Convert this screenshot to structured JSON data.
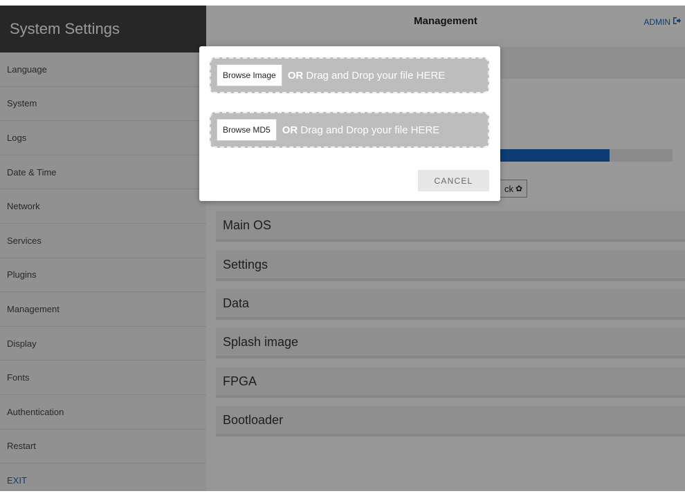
{
  "sidebar": {
    "title": "System Settings",
    "items": [
      {
        "label": "Language"
      },
      {
        "label": "System"
      },
      {
        "label": "Logs"
      },
      {
        "label": "Date & Time"
      },
      {
        "label": "Network"
      },
      {
        "label": "Services"
      },
      {
        "label": "Plugins"
      },
      {
        "label": "Management"
      },
      {
        "label": "Display"
      },
      {
        "label": "Fonts"
      },
      {
        "label": "Authentication"
      },
      {
        "label": "Restart"
      },
      {
        "label": "EXIT"
      }
    ]
  },
  "header": {
    "title": "Management",
    "user_label": "ADMIN",
    "user_icon": "logout-icon"
  },
  "update_panel": {
    "progress_fraction": 0.84,
    "check_label": "ck",
    "check_icon": "gear-icon",
    "accent_color": "#1565c0"
  },
  "sections": [
    {
      "label": "Main OS"
    },
    {
      "label": "Settings"
    },
    {
      "label": "Data"
    },
    {
      "label": "Splash image"
    },
    {
      "label": "FPGA"
    },
    {
      "label": "Bootloader"
    }
  ],
  "modal": {
    "image_drop": {
      "button_label": "Browse Image",
      "or_label": "OR",
      "drop_text": "Drag and Drop your file HERE"
    },
    "md5_drop": {
      "button_label": "Browse MD5",
      "or_label": "OR",
      "drop_text": "Drag and Drop your file HERE"
    },
    "cancel_label": "CANCEL"
  }
}
